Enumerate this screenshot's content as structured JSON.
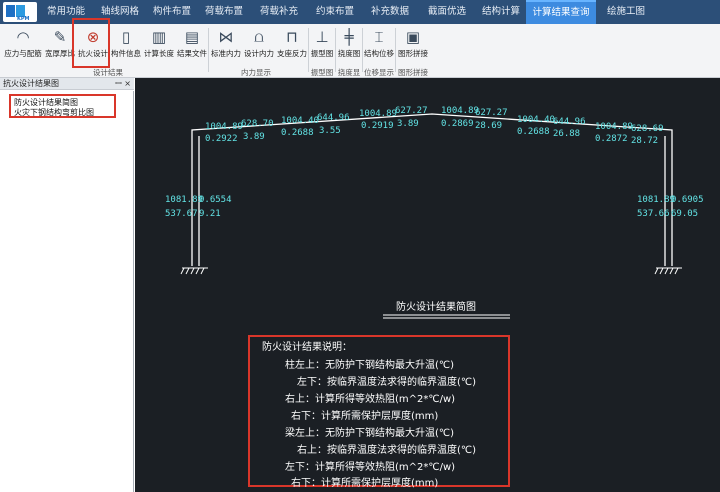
{
  "menubar": {
    "tabs": [
      {
        "label": "常用功能",
        "active": false
      },
      {
        "label": "轴线网格",
        "active": false
      },
      {
        "label": "构件布置",
        "active": false
      },
      {
        "label": "荷载布置",
        "active": false
      },
      {
        "label": "荷载补充",
        "active": false
      },
      {
        "label": "约束布置",
        "active": false
      },
      {
        "label": "补充数据",
        "active": false
      },
      {
        "label": "截面优选",
        "active": false
      },
      {
        "label": "结构计算",
        "active": false
      },
      {
        "label": "计算结果查询",
        "active": true
      },
      {
        "label": "绘施工图",
        "active": false
      }
    ]
  },
  "ribbon": {
    "buttons": [
      {
        "label": "应力与配筋",
        "icon": "stress-icon"
      },
      {
        "label": "宽厚厚比",
        "icon": "ratio-icon"
      },
      {
        "label": "抗火设计",
        "icon": "fire-design-icon"
      },
      {
        "label": "构件信息",
        "icon": "member-info-icon"
      },
      {
        "label": "计算长度",
        "icon": "calc-length-icon"
      },
      {
        "label": "结果文件",
        "icon": "result-file-icon"
      },
      {
        "label": "标准内力",
        "icon": "standard-force-icon"
      },
      {
        "label": "设计内力",
        "icon": "design-force-icon"
      },
      {
        "label": "支座反力",
        "icon": "reaction-icon"
      },
      {
        "label": "振型图",
        "icon": "mode-shape-icon"
      },
      {
        "label": "挠度图",
        "icon": "deflection-icon"
      },
      {
        "label": "结构位移",
        "icon": "displacement-icon"
      },
      {
        "label": "图形拼接",
        "icon": "image-merge-icon"
      }
    ],
    "groups": [
      "设计结果",
      "内力显示",
      "振型图",
      "挠度显示",
      "位移显示",
      "图形拼接"
    ]
  },
  "left_panel": {
    "title": "抗火设计结果图",
    "pin_glyph": "ꟷ",
    "close_glyph": "×",
    "items": [
      "防火设计结果简图",
      "火灾下钢结构弯剪比图"
    ]
  },
  "drawing": {
    "beam_labels": [
      {
        "top_left": "1004.89",
        "top_right": "628.70",
        "bottom_left": "0.2922",
        "bottom_right": "3.89"
      },
      {
        "top_left": "1004.40",
        "top_right": "644.96",
        "bottom_left": "0.2688",
        "bottom_right": "3.55"
      },
      {
        "top_left": "1004.89",
        "top_right": "627.27",
        "bottom_left": "0.2919",
        "bottom_right": "3.89"
      },
      {
        "top_left": "1004.89",
        "top_right": "627.27",
        "bottom_left": "0.2869",
        "bottom_right": "28.69"
      },
      {
        "top_left": "1004.40",
        "top_right": "644.96",
        "bottom_left": "0.2688",
        "bottom_right": "26.88"
      },
      {
        "top_left": "1004.89",
        "top_right": "628.69",
        "bottom_left": "0.2872",
        "bottom_right": "28.72"
      }
    ],
    "left_column": {
      "top_left": "1081.89",
      "top_right": "0.6554",
      "bottom_left": "537.67",
      "bottom_right": "9.21"
    },
    "right_column": {
      "top_left": "1081.89",
      "top_right": "0.6905",
      "bottom_left": "537.66",
      "bottom_right": "69.05"
    },
    "diagram_title": "防火设计结果简图",
    "legend_title": "防火设计结果说明：",
    "legend_lines": [
      "柱左上：无防护下钢结构最大升温(℃)",
      "左下：按临界温度法求得的临界温度(℃)",
      "右上：计算所得等效热阻(m^2*℃/w)",
      "右下：计算所需保护层厚度(mm)",
      "梁左上：无防护下钢结构最大升温(℃)",
      "右上：按临界温度法求得的临界温度(℃)",
      "左下：计算所得等效热阻(m^2*℃/w)",
      "右下：计算所需保护层厚度(mm)"
    ]
  }
}
